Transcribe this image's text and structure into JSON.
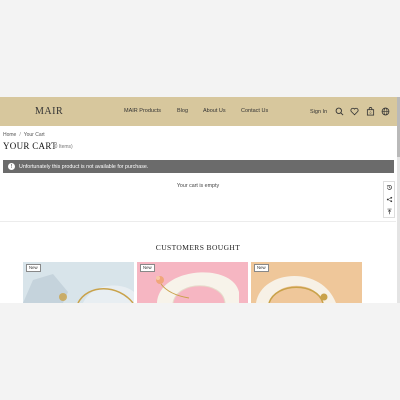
{
  "header": {
    "logo": "MAIR",
    "nav": [
      "MAIR Products",
      "Blog",
      "About Us",
      "Contact Us"
    ],
    "signin": "Sign In",
    "icons": [
      "search-icon",
      "heart-icon",
      "bag-icon",
      "globe-icon"
    ]
  },
  "breadcrumb": {
    "home": "Home",
    "separator": "/",
    "current": "Your Cart"
  },
  "cart": {
    "title": "YOUR CART",
    "count": "(0 Items)",
    "alert": "Unfortunately this product is not available for purchase.",
    "empty": "Your cart is empty"
  },
  "side_tools": [
    "history-icon",
    "share-icon",
    "back-to-top-icon"
  ],
  "customers_bought": {
    "title": "CUSTOMERS BOUGHT",
    "products": [
      {
        "badge": "New",
        "color": "#dde7ec"
      },
      {
        "badge": "New",
        "color": "#f6b6c2"
      },
      {
        "badge": "New",
        "color": "#efc79a"
      }
    ]
  },
  "colors": {
    "header_bg": "#d7c79d",
    "alert_bg": "#6b6b6b",
    "accent_gold": "#c9a24a"
  }
}
